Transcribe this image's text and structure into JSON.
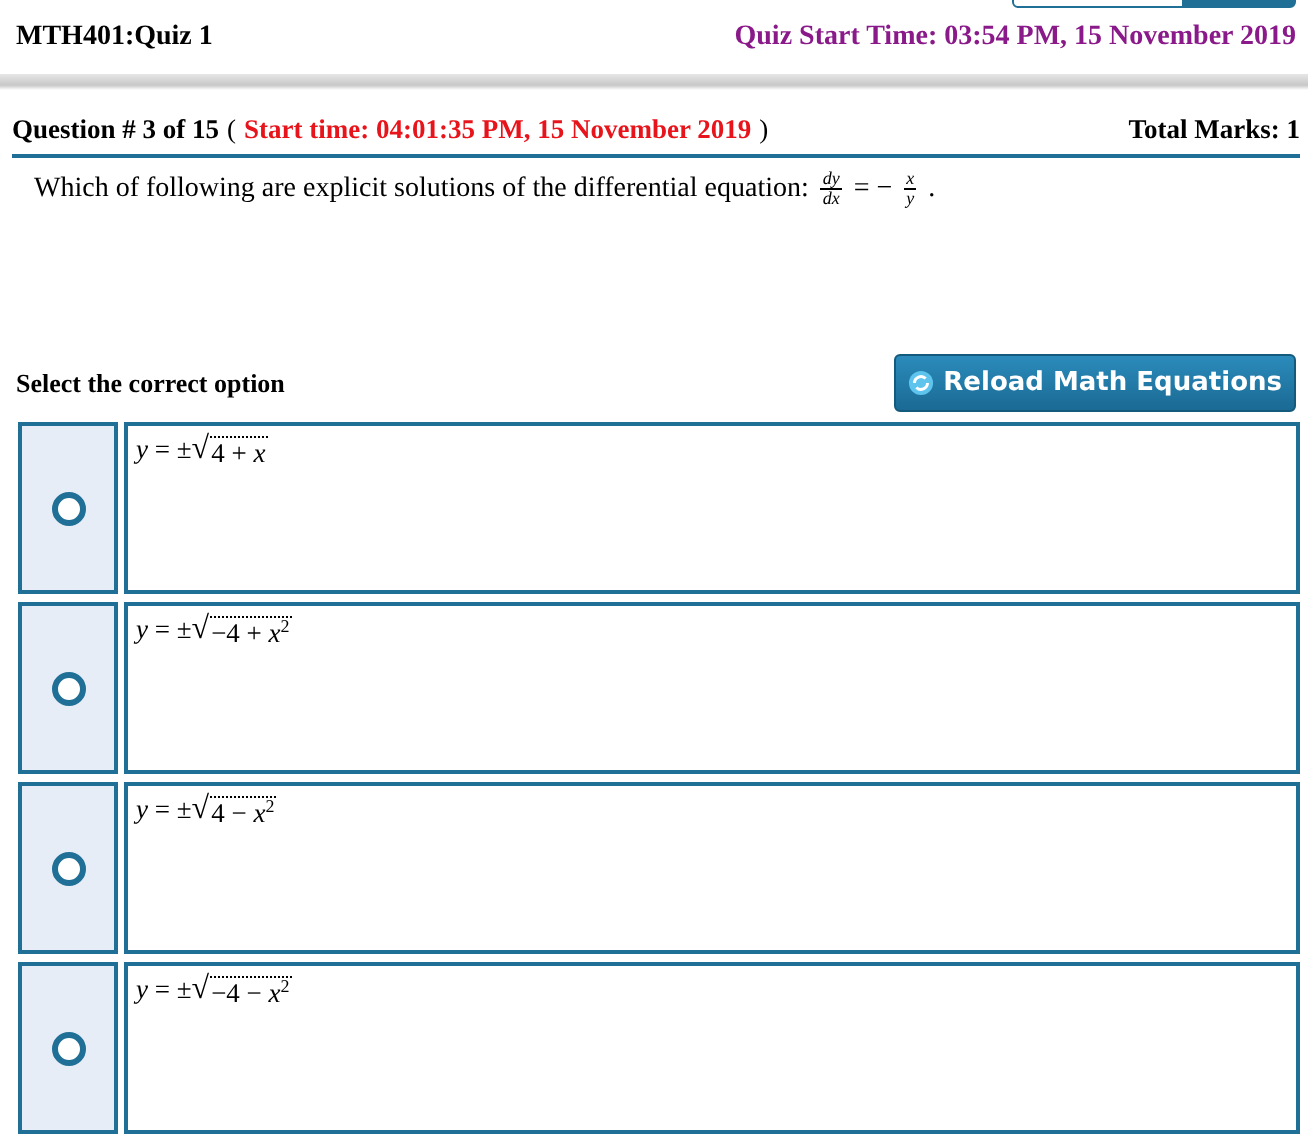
{
  "header": {
    "title": "MTH401:Quiz 1",
    "start_time": "Quiz Start Time: 03:54 PM, 15 November 2019"
  },
  "question": {
    "number": "Question # 3 of 15",
    "open": "(",
    "start_time": "Start time: 04:01:35 PM, 15 November 2019",
    "close": ")",
    "total_marks": "Total Marks: 1",
    "text": "Which of following are explicit solutions of the differential equation:",
    "equation": {
      "lhs_num": "dy",
      "lhs_den": "dx",
      "operator": "= −",
      "rhs_num": "x",
      "rhs_den": "y",
      "end": "."
    }
  },
  "prompt": "Select the correct option",
  "reload_button": "Reload Math Equations",
  "options": [
    {
      "prefix": "*y* = ±",
      "radical": "√",
      "radicand": "4 + *x*",
      "selected": false
    },
    {
      "prefix": "*y* = ±",
      "radical": "√",
      "radicand": "−4 + *x*$^{2}$",
      "selected": false
    },
    {
      "prefix": "*y* = ±",
      "radical": "√",
      "radicand": "4 − *x*$^{2}$",
      "selected": false
    },
    {
      "prefix": "*y* = ±",
      "radical": "√",
      "radicand": "−4 − *x*$^{2}$",
      "selected": false
    }
  ]
}
